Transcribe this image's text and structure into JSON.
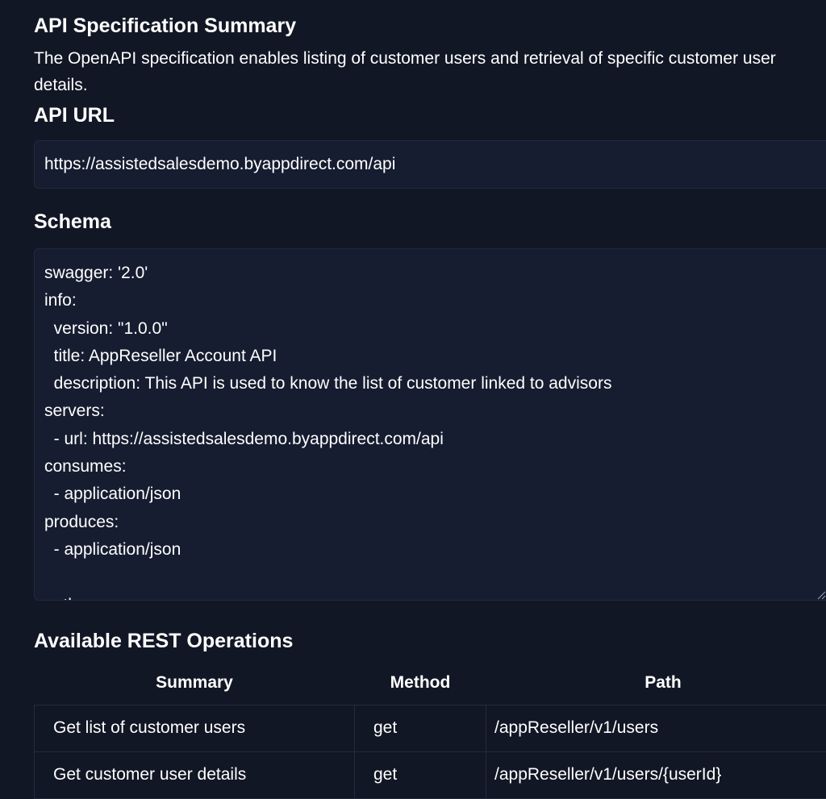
{
  "summary": {
    "heading": "API Specification Summary",
    "text": "The OpenAPI specification enables listing of customer users and retrieval of specific customer user details."
  },
  "api_url": {
    "heading": "API URL",
    "value": "https://assistedsalesdemo.byappdirect.com/api"
  },
  "schema": {
    "heading": "Schema",
    "value": "swagger: '2.0'\ninfo:\n  version: \"1.0.0\"\n  title: AppReseller Account API\n  description: This API is used to know the list of customer linked to advisors\nservers:\n  - url: https://assistedsalesdemo.byappdirect.com/api\nconsumes:\n  - application/json\nproduces:\n  - application/json\n\npaths:"
  },
  "operations": {
    "heading": "Available REST Operations",
    "columns": [
      "Summary",
      "Method",
      "Path"
    ],
    "rows": [
      {
        "summary": "Get list of customer users",
        "method": "get",
        "path": "/appReseller/v1/users"
      },
      {
        "summary": "Get customer user details",
        "method": "get",
        "path": "/appReseller/v1/users/{userId}"
      }
    ]
  },
  "colors": {
    "background": "#121725",
    "field_background": "#161d30",
    "border": "#232b3e",
    "text": "#ffffff"
  }
}
